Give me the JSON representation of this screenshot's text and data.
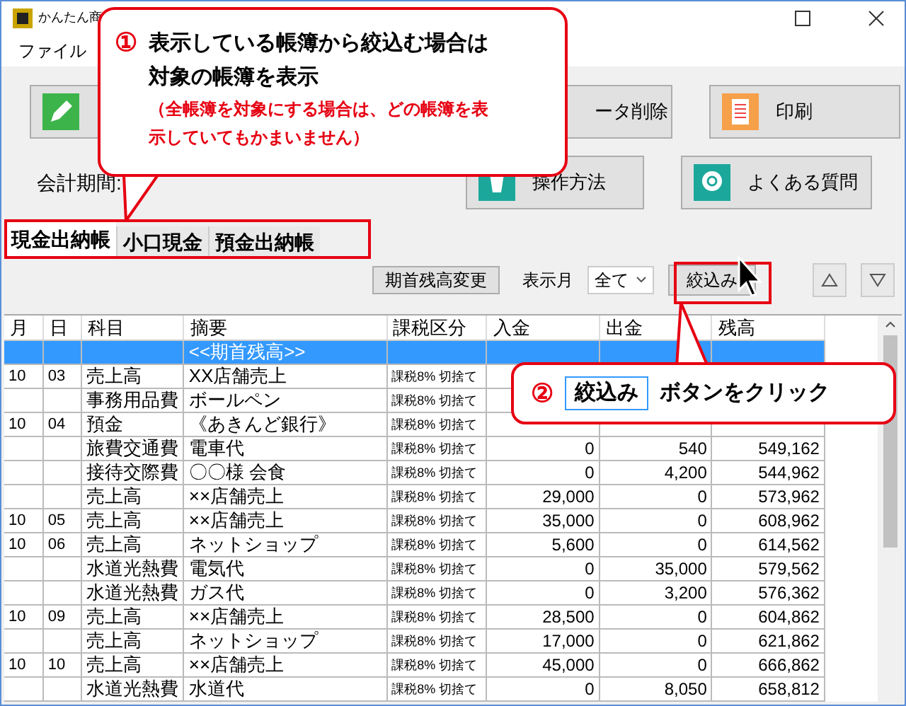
{
  "window": {
    "title": "かんたん商"
  },
  "menu": [
    "ファイル"
  ],
  "buttons_row1": [
    {
      "kind": "pencil"
    },
    {
      "kind": "plain",
      "label": "ータ削除"
    },
    {
      "kind": "print",
      "label": "印刷"
    }
  ],
  "period_label": "会計期間:",
  "buttons_row2": [
    {
      "kind": "manual",
      "label": "操作方法"
    },
    {
      "kind": "faq",
      "label": "よくある質問"
    }
  ],
  "tabs": [
    {
      "label": "現金出納帳",
      "selected": true
    },
    {
      "label": "小口現金",
      "selected": false
    },
    {
      "label": "預金出納帳",
      "selected": false
    }
  ],
  "toolbar": {
    "balance_button": "期首残高変更",
    "month_label": "表示月",
    "month_value": "全て",
    "filter_button": "絞込み"
  },
  "table": {
    "columns": [
      "月",
      "日",
      "科目",
      "摘要",
      "課税区分",
      "入金",
      "出金",
      "残高"
    ],
    "rows": [
      {
        "selected": true,
        "cells": [
          "",
          "",
          "",
          "<<期首残高>>",
          "",
          "",
          "",
          ""
        ]
      },
      {
        "selected": false,
        "cells": [
          "10",
          "03",
          "売上高",
          "XX店舗売上",
          "課税8% 切捨て",
          "",
          "",
          ""
        ]
      },
      {
        "selected": false,
        "cells": [
          "",
          "",
          "事務用品費",
          "ボールペン",
          "課税8% 切捨て",
          "",
          "",
          ""
        ]
      },
      {
        "selected": false,
        "cells": [
          "10",
          "04",
          "預金",
          "《あきんど銀行》",
          "課税8% 切捨て",
          "",
          "",
          ""
        ]
      },
      {
        "selected": false,
        "cells": [
          "",
          "",
          "旅費交通費",
          "電車代",
          "課税8% 切捨て",
          "0",
          "540",
          "549,162"
        ]
      },
      {
        "selected": false,
        "cells": [
          "",
          "",
          "接待交際費",
          "〇〇様 会食",
          "課税8% 切捨て",
          "0",
          "4,200",
          "544,962"
        ]
      },
      {
        "selected": false,
        "cells": [
          "",
          "",
          "売上高",
          "××店舗売上",
          "課税8% 切捨て",
          "29,000",
          "0",
          "573,962"
        ]
      },
      {
        "selected": false,
        "cells": [
          "10",
          "05",
          "売上高",
          "××店舗売上",
          "課税8% 切捨て",
          "35,000",
          "0",
          "608,962"
        ]
      },
      {
        "selected": false,
        "cells": [
          "10",
          "06",
          "売上高",
          "ネットショップ",
          "課税8% 切捨て",
          "5,600",
          "0",
          "614,562"
        ]
      },
      {
        "selected": false,
        "cells": [
          "",
          "",
          "水道光熱費",
          "電気代",
          "課税8% 切捨て",
          "0",
          "35,000",
          "579,562"
        ]
      },
      {
        "selected": false,
        "cells": [
          "",
          "",
          "水道光熱費",
          "ガス代",
          "課税8% 切捨て",
          "0",
          "3,200",
          "576,362"
        ]
      },
      {
        "selected": false,
        "cells": [
          "10",
          "09",
          "売上高",
          "××店舗売上",
          "課税8% 切捨て",
          "28,500",
          "0",
          "604,862"
        ]
      },
      {
        "selected": false,
        "cells": [
          "",
          "",
          "売上高",
          "ネットショップ",
          "課税8% 切捨て",
          "17,000",
          "0",
          "621,862"
        ]
      },
      {
        "selected": false,
        "cells": [
          "10",
          "10",
          "売上高",
          "××店舗売上",
          "課税8% 切捨て",
          "45,000",
          "0",
          "666,862"
        ]
      },
      {
        "selected": false,
        "cells": [
          "",
          "",
          "水道光熱費",
          "水道代",
          "課税8% 切捨て",
          "0",
          "8,050",
          "658,812"
        ]
      }
    ]
  },
  "callout_1": {
    "number": "①",
    "heading": "表示している帳簿から絞込む場合は対象の帳簿を表示",
    "note": "（全帳簿を対象にする場合は、どの帳簿を表示していてもかまいません）"
  },
  "callout_2": {
    "number": "②",
    "button_label": "絞込み",
    "text": "ボタンをクリック"
  }
}
